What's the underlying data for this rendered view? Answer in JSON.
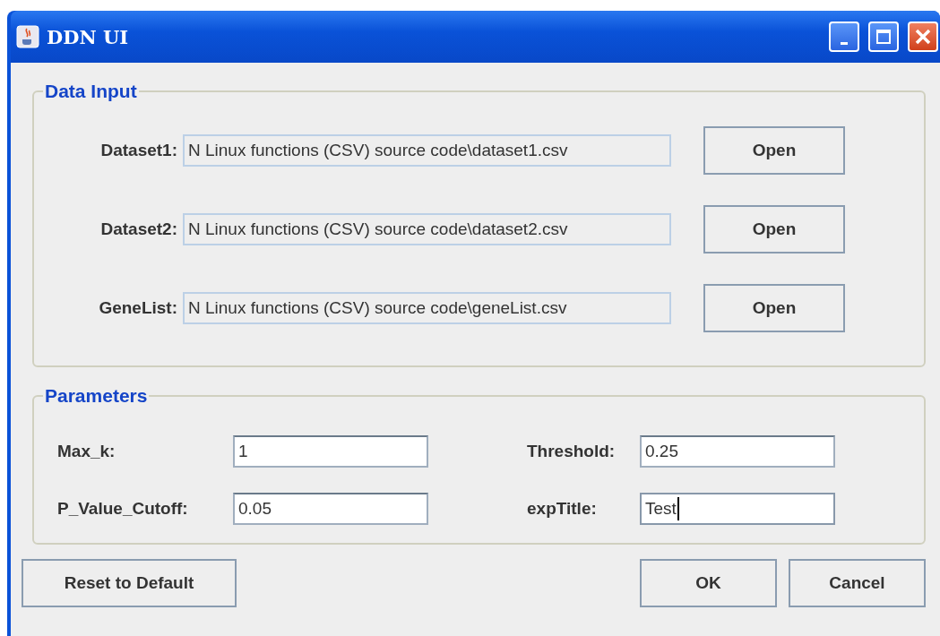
{
  "window": {
    "title": "DDN UI"
  },
  "data_input": {
    "title": "Data Input",
    "rows": [
      {
        "label": "Dataset1:",
        "value": "N Linux functions (CSV) source code\\dataset1.csv",
        "button": "Open"
      },
      {
        "label": "Dataset2:",
        "value": "N Linux functions (CSV) source code\\dataset2.csv",
        "button": "Open"
      },
      {
        "label": "GeneList:",
        "value": "N Linux functions (CSV) source code\\geneList.csv",
        "button": "Open"
      }
    ]
  },
  "parameters": {
    "title": "Parameters",
    "fields": [
      {
        "label": "Max_k:",
        "value": "1",
        "focused": false
      },
      {
        "label": "Threshold:",
        "value": "0.25",
        "focused": false
      },
      {
        "label": "P_Value_Cutoff:",
        "value": "0.05",
        "focused": false
      },
      {
        "label": "expTitle:",
        "value": "Test",
        "focused": true
      }
    ]
  },
  "buttons": {
    "reset": "Reset to Default",
    "ok": "OK",
    "cancel": "Cancel"
  }
}
